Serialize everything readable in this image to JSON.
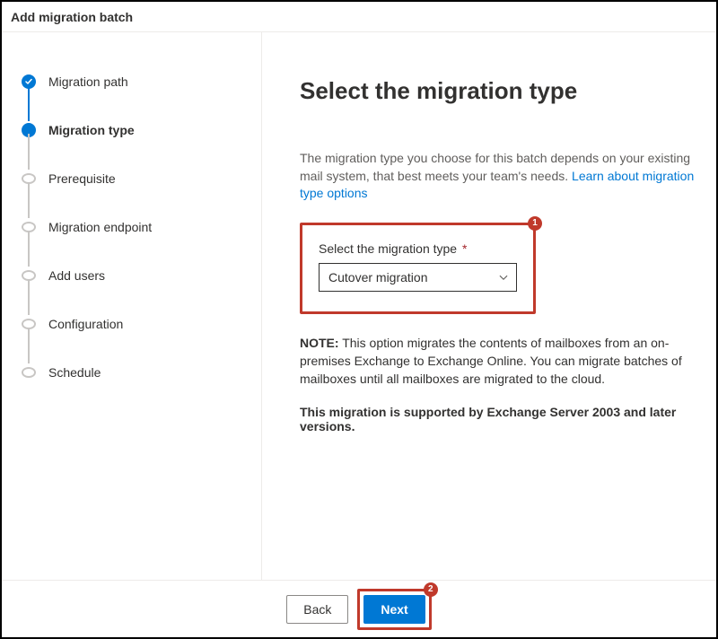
{
  "window_title": "Add migration batch",
  "sidebar": {
    "steps": [
      {
        "label": "Migration path",
        "state": "completed"
      },
      {
        "label": "Migration type",
        "state": "current"
      },
      {
        "label": "Prerequisite",
        "state": "upcoming"
      },
      {
        "label": "Migration endpoint",
        "state": "upcoming"
      },
      {
        "label": "Add users",
        "state": "upcoming"
      },
      {
        "label": "Configuration",
        "state": "upcoming"
      },
      {
        "label": "Schedule",
        "state": "upcoming"
      }
    ]
  },
  "main": {
    "heading": "Select the migration type",
    "intro_text": "The migration type you choose for this batch depends on your existing mail system, that best meets your team's needs. ",
    "intro_link": "Learn about migration type options",
    "field_label": "Select the migration type",
    "required_mark": "*",
    "select_value": "Cutover migration",
    "note_label": "NOTE:",
    "note_text": " This option migrates the contents of mailboxes from an on-premises Exchange to Exchange Online. You can migrate batches of mailboxes until all mailboxes are migrated to the cloud.",
    "support_text": "This migration is supported by Exchange Server 2003 and later versions."
  },
  "annotations": {
    "callout1": "1",
    "callout2": "2"
  },
  "footer": {
    "back": "Back",
    "next": "Next"
  }
}
